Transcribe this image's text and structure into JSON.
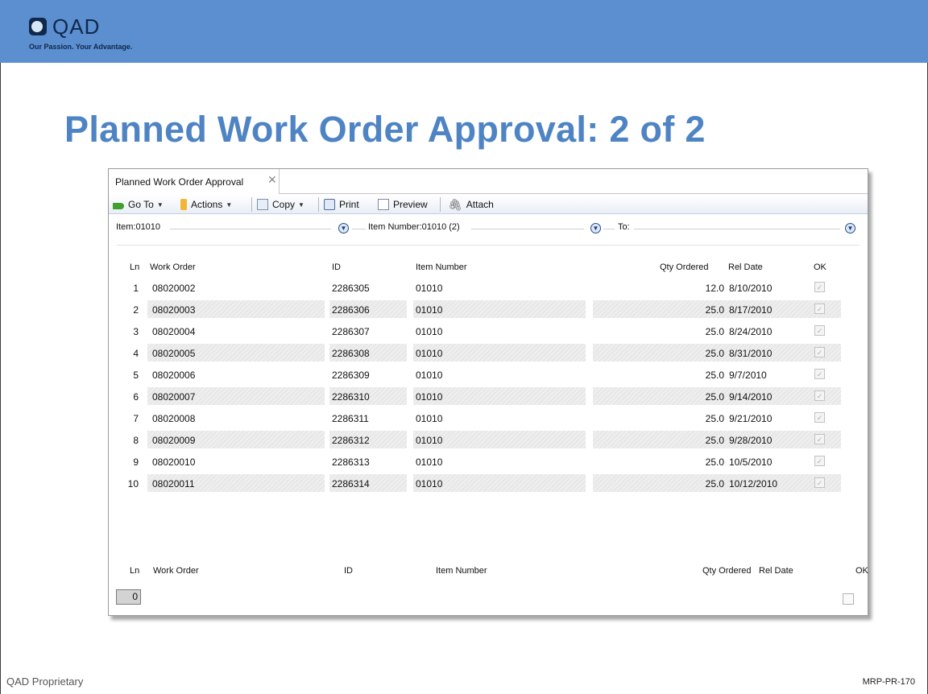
{
  "brand": {
    "name": "QAD",
    "tagline": "Our Passion. Your Advantage.",
    "banner_color": "#5b8fd0",
    "title_color": "#4f84c4"
  },
  "slide": {
    "title": "Planned Work Order Approval: 2 of 2",
    "footer_left": "QAD Proprietary",
    "footer_right": "MRP-PR-170"
  },
  "window": {
    "tab_label": "Planned Work Order Approval",
    "tab_close_icon": "close-icon",
    "toolbar": {
      "goto_label": "Go To",
      "actions_label": "Actions",
      "copy_label": "Copy",
      "print_label": "Print",
      "preview_label": "Preview",
      "attach_label": "Attach"
    },
    "filters": {
      "item": "Item:01010",
      "item_number": "Item Number:01010 (2)",
      "to": "To:"
    },
    "columns": {
      "ln": "Ln",
      "work_order": "Work Order",
      "id": "ID",
      "item_number": "Item Number",
      "qty_ordered": "Qty Ordered",
      "rel_date": "Rel Date",
      "ok": "OK"
    },
    "rows": [
      {
        "ln": "1",
        "work_order": "08020002",
        "id": "2286305",
        "item_number": "01010",
        "qty": "12.0",
        "rel_date": "8/10/2010",
        "ok": true
      },
      {
        "ln": "2",
        "work_order": "08020003",
        "id": "2286306",
        "item_number": "01010",
        "qty": "25.0",
        "rel_date": "8/17/2010",
        "ok": true
      },
      {
        "ln": "3",
        "work_order": "08020004",
        "id": "2286307",
        "item_number": "01010",
        "qty": "25.0",
        "rel_date": "8/24/2010",
        "ok": true
      },
      {
        "ln": "4",
        "work_order": "08020005",
        "id": "2286308",
        "item_number": "01010",
        "qty": "25.0",
        "rel_date": "8/31/2010",
        "ok": true
      },
      {
        "ln": "5",
        "work_order": "08020006",
        "id": "2286309",
        "item_number": "01010",
        "qty": "25.0",
        "rel_date": "9/7/2010",
        "ok": true
      },
      {
        "ln": "6",
        "work_order": "08020007",
        "id": "2286310",
        "item_number": "01010",
        "qty": "25.0",
        "rel_date": "9/14/2010",
        "ok": true
      },
      {
        "ln": "7",
        "work_order": "08020008",
        "id": "2286311",
        "item_number": "01010",
        "qty": "25.0",
        "rel_date": "9/21/2010",
        "ok": true
      },
      {
        "ln": "8",
        "work_order": "08020009",
        "id": "2286312",
        "item_number": "01010",
        "qty": "25.0",
        "rel_date": "9/28/2010",
        "ok": true
      },
      {
        "ln": "9",
        "work_order": "08020010",
        "id": "2286313",
        "item_number": "01010",
        "qty": "25.0",
        "rel_date": "10/5/2010",
        "ok": true
      },
      {
        "ln": "10",
        "work_order": "08020011",
        "id": "2286314",
        "item_number": "01010",
        "qty": "25.0",
        "rel_date": "10/12/2010",
        "ok": true
      }
    ],
    "entry": {
      "ln_value": "0",
      "ok": false
    }
  }
}
